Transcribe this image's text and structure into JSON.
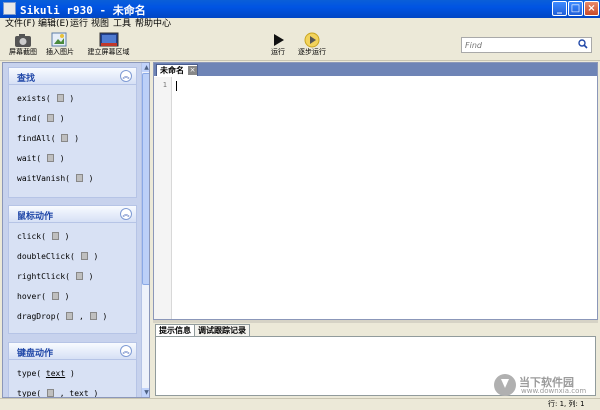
{
  "window": {
    "title": "Sikuli r930 - 未命名"
  },
  "menu": [
    "文件(F)",
    "编辑(E)",
    "运行",
    "视图",
    "工具",
    "帮助中心"
  ],
  "toolbar": {
    "capture_label": "屏幕截图",
    "insert_image_label": "插入图片",
    "region_label": "建立屏幕区域",
    "run_label": "运行",
    "step_run_label": "逐步运行",
    "search_placeholder": "Find"
  },
  "sidebar": {
    "find_header": "查找",
    "find_cmds": [
      "exists(",
      "find(",
      "findAll(",
      "wait(",
      "waitVanish("
    ],
    "mouse_header": "鼠标动作",
    "mouse_cmds": [
      "click(",
      "doubleClick(",
      "rightClick(",
      "hover(",
      "dragDrop("
    ],
    "keyboard_header": "键盘动作",
    "keyboard_cmds": [
      "type(",
      "type("
    ],
    "type_arg": "text",
    "close_paren": ")",
    "comma": ","
  },
  "editor": {
    "tab_label": "未命名",
    "line_numbers": [
      "1"
    ]
  },
  "console": {
    "tab_messages": "提示信息",
    "tab_trace": "调试跟踪记录"
  },
  "status": {
    "position": "行: 1, 列: 1"
  },
  "watermark": {
    "title": "当下软件园",
    "url": "www.downxia.com"
  },
  "colors": {
    "titlebar": "#0054e3",
    "sidebar": "#c7d2ed",
    "panel_header_text": "#2148a8"
  }
}
